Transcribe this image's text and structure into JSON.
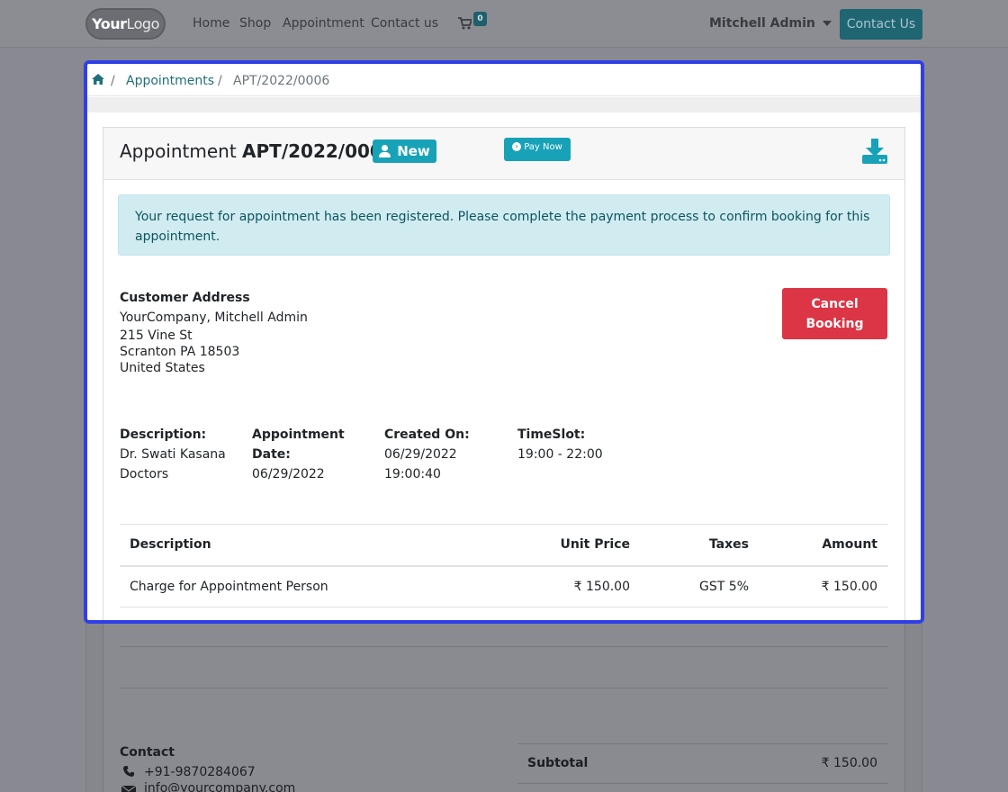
{
  "nav": {
    "logo_word": "Your",
    "logo_word2": "Logo",
    "links": [
      "Home",
      "Shop",
      "Appointment",
      "Contact us"
    ],
    "cart_count": "0",
    "user": "Mitchell Admin",
    "contact_button": "Contact Us"
  },
  "breadcrumb": {
    "sep": "/",
    "link": "Appointments",
    "current": "APT/2022/0006"
  },
  "appointment": {
    "title_prefix": "Appointment",
    "number": "APT/2022/0006",
    "status": "New",
    "pay_button": "Pay Now",
    "alert": "Your request for appointment has been registered. Please complete the payment process to confirm booking for this appointment.",
    "cancel_button_1": "Cancel",
    "cancel_button_2": "Booking"
  },
  "customer": {
    "heading": "Customer Address",
    "name": "YourCompany, Mitchell Admin",
    "street": "215 Vine St",
    "city": "Scranton PA 18503",
    "country": "United States"
  },
  "details": {
    "description_label": "Description:",
    "description_value_1": "Dr. Swati Kasana",
    "description_value_2": "Doctors",
    "date_label_1": "Appointment",
    "date_label_2": "Date:",
    "date_value": "06/29/2022",
    "created_label": "Created On:",
    "created_value_1": "06/29/2022",
    "created_value_2": "19:00:40",
    "slot_label": "TimeSlot:",
    "slot_value": "19:00 - 22:00"
  },
  "table": {
    "headers": [
      "Description",
      "Unit Price",
      "Taxes",
      "Amount"
    ],
    "rows": [
      [
        "Charge for Appointment Person",
        "₹ 150.00",
        "GST 5%",
        "₹ 150.00"
      ]
    ]
  },
  "footer": {
    "contact_heading": "Contact",
    "phone": "+91-9870284067",
    "email": "info@yourcompany.com",
    "subtotal_label": "Subtotal",
    "subtotal_value": "₹ 150.00"
  },
  "colors": {
    "highlight_border": "#2f3fe8",
    "info": "#17a2b8",
    "danger": "#dc3545",
    "link": "#1f6f7c"
  }
}
